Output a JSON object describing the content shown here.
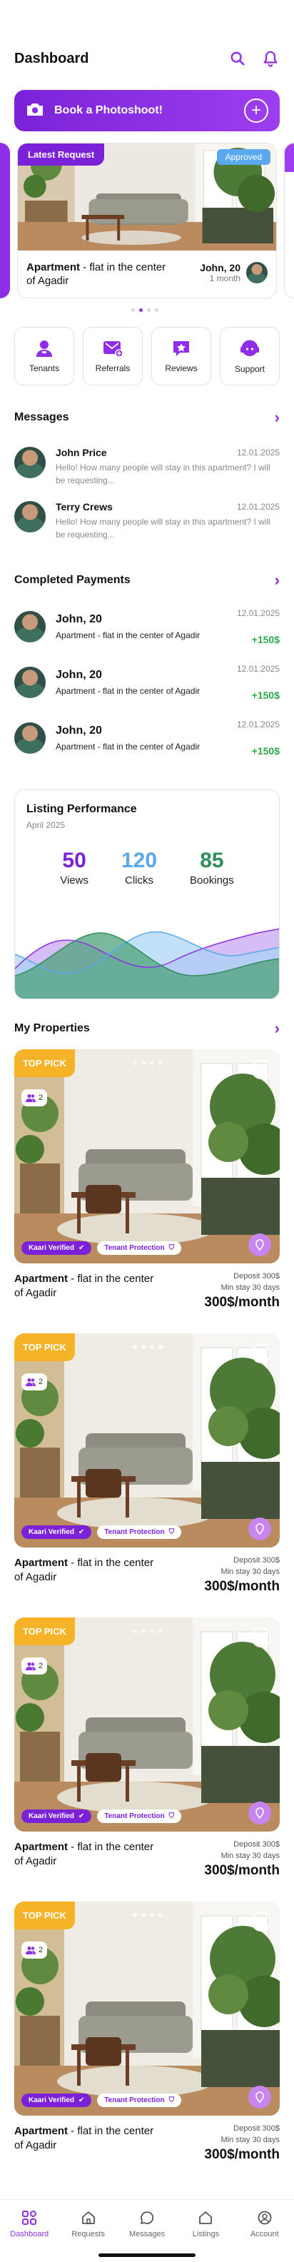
{
  "header": {
    "title": "Dashboard"
  },
  "banner": {
    "label": "Book a Photoshoot!"
  },
  "latest_request": {
    "label": "Latest Request",
    "status": "Approved",
    "title_bold": "Apartment",
    "title_rest": " - flat in the center of Agadir",
    "user_name": "John, 20",
    "duration": "1 month"
  },
  "quick_actions": [
    {
      "label": "Tenants"
    },
    {
      "label": "Referrals"
    },
    {
      "label": "Reviews"
    },
    {
      "label": "Support"
    }
  ],
  "messages": {
    "title": "Messages",
    "items": [
      {
        "name": "John Price",
        "date": "12.01.2025",
        "text": "Hello! How many people will stay in this apartment? I will be requesting..."
      },
      {
        "name": "Terry Crews",
        "date": "12.01.2025",
        "text": "Hello! How many people will stay in this apartment? I will be requesting..."
      }
    ]
  },
  "payments": {
    "title": "Completed Payments",
    "items": [
      {
        "name": "John, 20",
        "desc": "Apartment - flat in the center of Agadir",
        "date": "12.01.2025",
        "amount": "+150$"
      },
      {
        "name": "John, 20",
        "desc": "Apartment - flat in the center of Agadir",
        "date": "12.01.2025",
        "amount": "+150$"
      },
      {
        "name": "John, 20",
        "desc": "Apartment - flat in the center of Agadir",
        "date": "12.01.2025",
        "amount": "+150$"
      }
    ]
  },
  "performance": {
    "title": "Listing Performance",
    "date": "April 2025",
    "stats": [
      {
        "value": "50",
        "label": "Views",
        "color": "#7b22d8"
      },
      {
        "value": "120",
        "label": "Clicks",
        "color": "#5aa8f0"
      },
      {
        "value": "85",
        "label": "Bookings",
        "color": "#2e8f5a"
      }
    ]
  },
  "properties": {
    "title": "My Properties",
    "items": [
      {
        "tag": "TOP PICK",
        "guests": "2",
        "verified": "Kaari Verified",
        "protection": "Tenant Protection",
        "title_bold": "Apartment",
        "title_rest": " - flat in the center of Agadir",
        "deposit": "Deposit 300$",
        "min_stay": "Min stay 30 days",
        "price": "300$/month"
      },
      {
        "tag": "TOP PICK",
        "guests": "2",
        "verified": "Kaari Verified",
        "protection": "Tenant Protection",
        "title_bold": "Apartment",
        "title_rest": " - flat in the center of Agadir",
        "deposit": "Deposit 300$",
        "min_stay": "Min stay 30 days",
        "price": "300$/month"
      },
      {
        "tag": "TOP PICK",
        "guests": "2",
        "verified": "Kaari Verified",
        "protection": "Tenant Protection",
        "title_bold": "Apartment",
        "title_rest": " - flat in the center of Agadir",
        "deposit": "Deposit 300$",
        "min_stay": "Min stay 30 days",
        "price": "300$/month"
      },
      {
        "tag": "TOP PICK",
        "guests": "2",
        "verified": "Kaari Verified",
        "protection": "Tenant Protection",
        "title_bold": "Apartment",
        "title_rest": " - flat in the center of Agadir",
        "deposit": "Deposit 300$",
        "min_stay": "Min stay 30 days",
        "price": "300$/month"
      }
    ]
  },
  "bottom_nav": [
    {
      "label": "Dashboard",
      "icon": "dashboard-icon",
      "active": true
    },
    {
      "label": "Requests",
      "icon": "home-icon",
      "active": false
    },
    {
      "label": "Messages",
      "icon": "chat-icon",
      "active": false
    },
    {
      "label": "Listings",
      "icon": "home-icon",
      "active": false
    },
    {
      "label": "Account",
      "icon": "user-icon",
      "active": false
    }
  ],
  "colors": {
    "accent": "#8e2ee8",
    "positive": "#2ea84a",
    "top_pick": "#f6b328",
    "approved": "#5aa8f0"
  }
}
